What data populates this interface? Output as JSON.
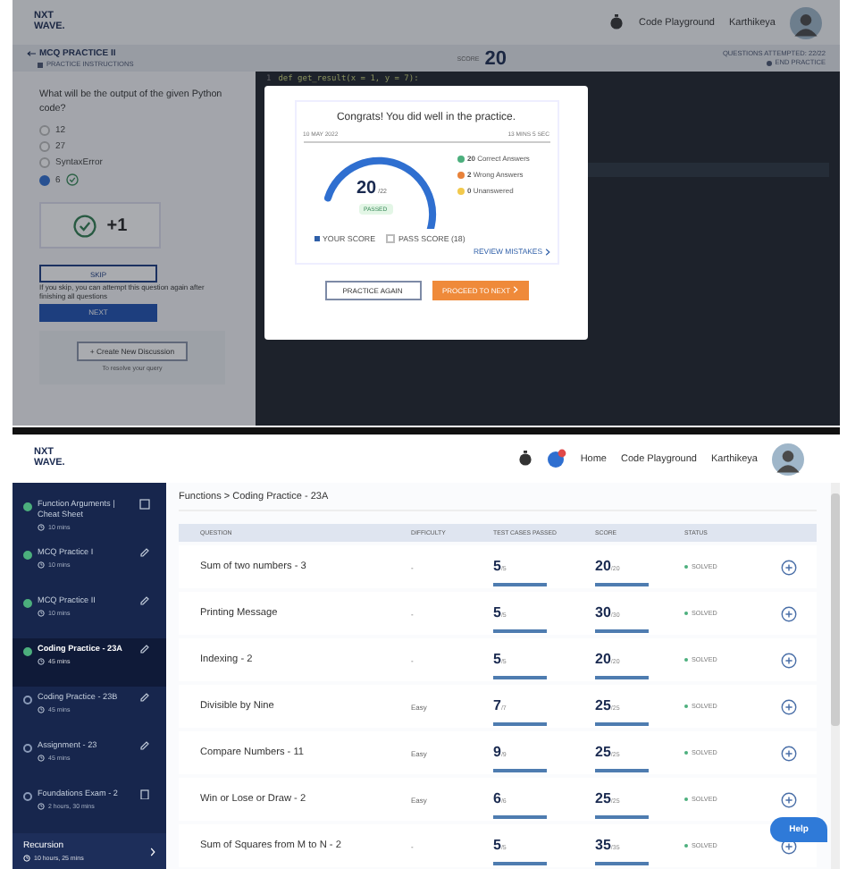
{
  "practice_screen": {
    "header": {
      "logo": [
        "NXT",
        "WAVE."
      ],
      "link": "Code Playground",
      "user": "Karthikeya"
    },
    "practice_bar": {
      "title": "MCQ PRACTICE II",
      "instructions": "PRACTICE INSTRUCTIONS",
      "score_label": "SCORE",
      "score": "20",
      "attempted": "QUESTIONS ATTEMPTED: 22/22",
      "end": "END PRACTICE"
    },
    "question": {
      "text": "What will be the output of the given Python code?",
      "options": [
        {
          "label": "12",
          "selected": false
        },
        {
          "label": "27",
          "selected": false
        },
        {
          "label": "SyntaxError",
          "selected": false
        },
        {
          "label": "6",
          "selected": true
        }
      ],
      "result": "+1",
      "skip": "SKIP",
      "skip_note": "If you skip, you can attempt this question again after finishing all questions",
      "next": "NEXT",
      "discussion": "+ Create New Discussion",
      "discussion_note": "To resolve your query"
    },
    "code_line": {
      "number": "1",
      "text": "def get_result(x = 1, y = 7):"
    },
    "modal": {
      "title": "Congrats! You did well in the practice.",
      "date": "10 MAY 2022",
      "duration": "13 MINS 5 SEC",
      "score": "20",
      "total": "/22",
      "badge": "PASSED",
      "stats": [
        {
          "count": "20",
          "label": "Correct Answers",
          "kind": "correct"
        },
        {
          "count": "2",
          "label": "Wrong Answers",
          "kind": "wrong"
        },
        {
          "count": "0",
          "label": "Unanswered",
          "kind": "unanswered"
        }
      ],
      "legend": [
        "YOUR SCORE",
        "PASS SCORE (18)"
      ],
      "review": "REVIEW MISTAKES",
      "practice_again": "PRACTICE AGAIN",
      "proceed": "PROCEED TO NEXT"
    }
  },
  "course_screen": {
    "header": {
      "logo": [
        "NXT",
        "WAVE."
      ],
      "links": [
        "Home",
        "Code Playground"
      ],
      "user": "Karthikeya"
    },
    "sidebar": {
      "items": [
        {
          "title": "Function Arguments | Cheat Sheet",
          "time": "10 mins",
          "kind": "note",
          "completed": true,
          "selected": false
        },
        {
          "title": "MCQ Practice I",
          "time": "10 mins",
          "kind": "pencil",
          "completed": true,
          "selected": false
        },
        {
          "title": "MCQ Practice II",
          "time": "10 mins",
          "kind": "pencil",
          "completed": true,
          "selected": false
        },
        {
          "title": "Coding Practice - 23A",
          "time": "45 mins",
          "kind": "pencil",
          "completed": true,
          "selected": true
        },
        {
          "title": "Coding Practice - 23B",
          "time": "45 mins",
          "kind": "pencil",
          "completed": false,
          "selected": false
        },
        {
          "title": "Assignment - 23",
          "time": "45 mins",
          "kind": "pencil",
          "completed": false,
          "selected": false
        },
        {
          "title": "Foundations Exam - 2",
          "time": "2 hours, 30 mins",
          "kind": "exam",
          "completed": false,
          "selected": false
        }
      ],
      "section": {
        "title": "Recursion",
        "time": "10 hours, 25 mins"
      }
    },
    "breadcrumb": "Functions > Coding Practice - 23A",
    "table": {
      "columns": [
        "QUESTION",
        "DIFFICULTY",
        "TEST CASES PASSED",
        "SCORE",
        "STATUS"
      ],
      "rows": [
        {
          "question": "Sum of two numbers - 3",
          "difficulty": "-",
          "tests": {
            "passed": "5",
            "total": "/5",
            "level": 1
          },
          "score": {
            "value": "20",
            "max": "/20",
            "level": 1
          },
          "status": "SOLVED"
        },
        {
          "question": "Printing Message",
          "difficulty": "-",
          "tests": {
            "passed": "5",
            "total": "/5",
            "level": 1
          },
          "score": {
            "value": "30",
            "max": "/30",
            "level": 1
          },
          "status": "SOLVED"
        },
        {
          "question": "Indexing - 2",
          "difficulty": "-",
          "tests": {
            "passed": "5",
            "total": "/5",
            "level": 1
          },
          "score": {
            "value": "20",
            "max": "/20",
            "level": 1
          },
          "status": "SOLVED"
        },
        {
          "question": "Divisible by Nine",
          "difficulty": "Easy",
          "tests": {
            "passed": "7",
            "total": "/7",
            "level": 1
          },
          "score": {
            "value": "25",
            "max": "/25",
            "level": 1
          },
          "status": "SOLVED"
        },
        {
          "question": "Compare Numbers - 11",
          "difficulty": "Easy",
          "tests": {
            "passed": "9",
            "total": "/9",
            "level": 1
          },
          "score": {
            "value": "25",
            "max": "/25",
            "level": 1
          },
          "status": "SOLVED"
        },
        {
          "question": "Win or Lose or Draw - 2",
          "difficulty": "Easy",
          "tests": {
            "passed": "6",
            "total": "/6",
            "level": 1
          },
          "score": {
            "value": "25",
            "max": "/25",
            "level": 1
          },
          "status": "SOLVED"
        },
        {
          "question": "Sum of Squares from M to N - 2",
          "difficulty": "-",
          "tests": {
            "passed": "5",
            "total": "/5",
            "level": 1
          },
          "score": {
            "value": "35",
            "max": "/35",
            "level": 1
          },
          "status": "SOLVED"
        }
      ]
    },
    "help": "Help"
  }
}
